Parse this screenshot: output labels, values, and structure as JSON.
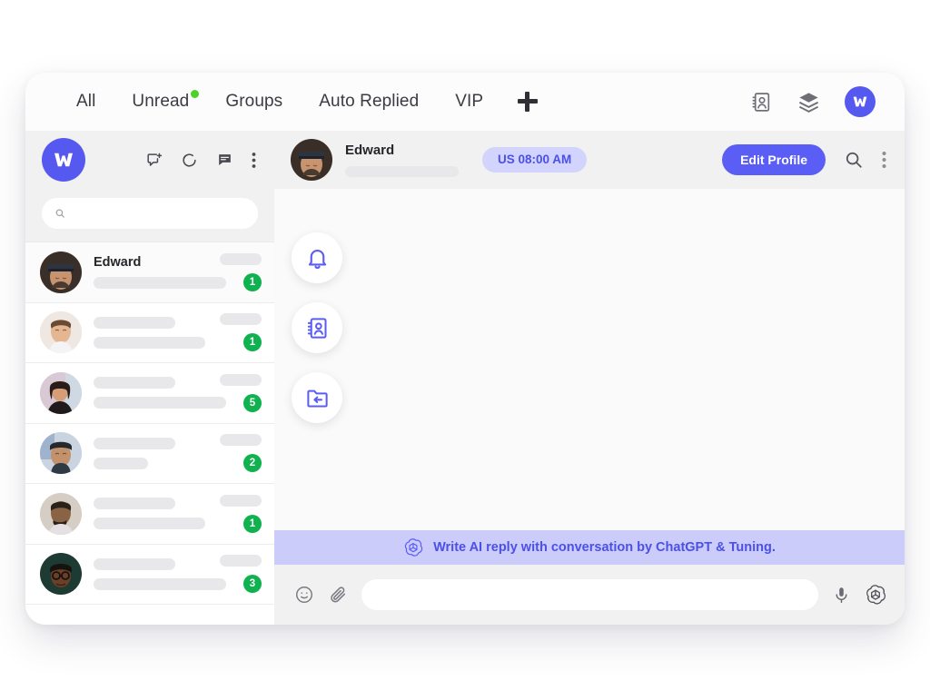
{
  "topbar": {
    "tabs": [
      {
        "label": "All",
        "unread_dot": false
      },
      {
        "label": "Unread",
        "unread_dot": true
      },
      {
        "label": "Groups",
        "unread_dot": false
      },
      {
        "label": "Auto Replied",
        "unread_dot": false
      },
      {
        "label": "VIP",
        "unread_dot": false
      }
    ],
    "add_tab_label": "+",
    "icons": [
      "contact-card-icon",
      "layers-icon"
    ],
    "account_logo_letter": "W"
  },
  "sidebar": {
    "logo_letter": "W",
    "header_icons": [
      "new-chat-icon",
      "refresh-icon",
      "chat-bubble-icon",
      "more-vertical-icon"
    ],
    "search": {
      "value": "",
      "placeholder": ""
    },
    "conversations": [
      {
        "name": "Edward",
        "badge": "1",
        "selected": true
      },
      {
        "name": "",
        "badge": "1",
        "selected": false
      },
      {
        "name": "",
        "badge": "5",
        "selected": false
      },
      {
        "name": "",
        "badge": "2",
        "selected": false
      },
      {
        "name": "",
        "badge": "1",
        "selected": false
      },
      {
        "name": "",
        "badge": "3",
        "selected": false
      }
    ]
  },
  "chat": {
    "contact_name": "Edward",
    "timezone_badge": "US 08:00 AM",
    "edit_profile_label": "Edit Profile",
    "header_icons": [
      "search-icon",
      "more-vertical-icon"
    ],
    "floating_actions": [
      "bell-icon",
      "contact-card-icon",
      "folder-reply-icon"
    ],
    "ai_banner": {
      "icon": "openai-icon",
      "text": "Write AI reply with conversation by ChatGPT & Tuning."
    },
    "composer": {
      "emoji_icon": "emoji-icon",
      "attach_icon": "paperclip-icon",
      "input_value": "",
      "input_placeholder": "",
      "mic_icon": "microphone-icon",
      "ai_icon": "openai-icon"
    }
  },
  "colors": {
    "brand_blue": "#5659f0",
    "accent_blue": "#5b5ef5",
    "badge_green": "#0fb24f",
    "unread_dot_green": "#4cd32a",
    "banner_bg": "#ccccfb",
    "tz_badge_bg": "#d3d4fe"
  }
}
